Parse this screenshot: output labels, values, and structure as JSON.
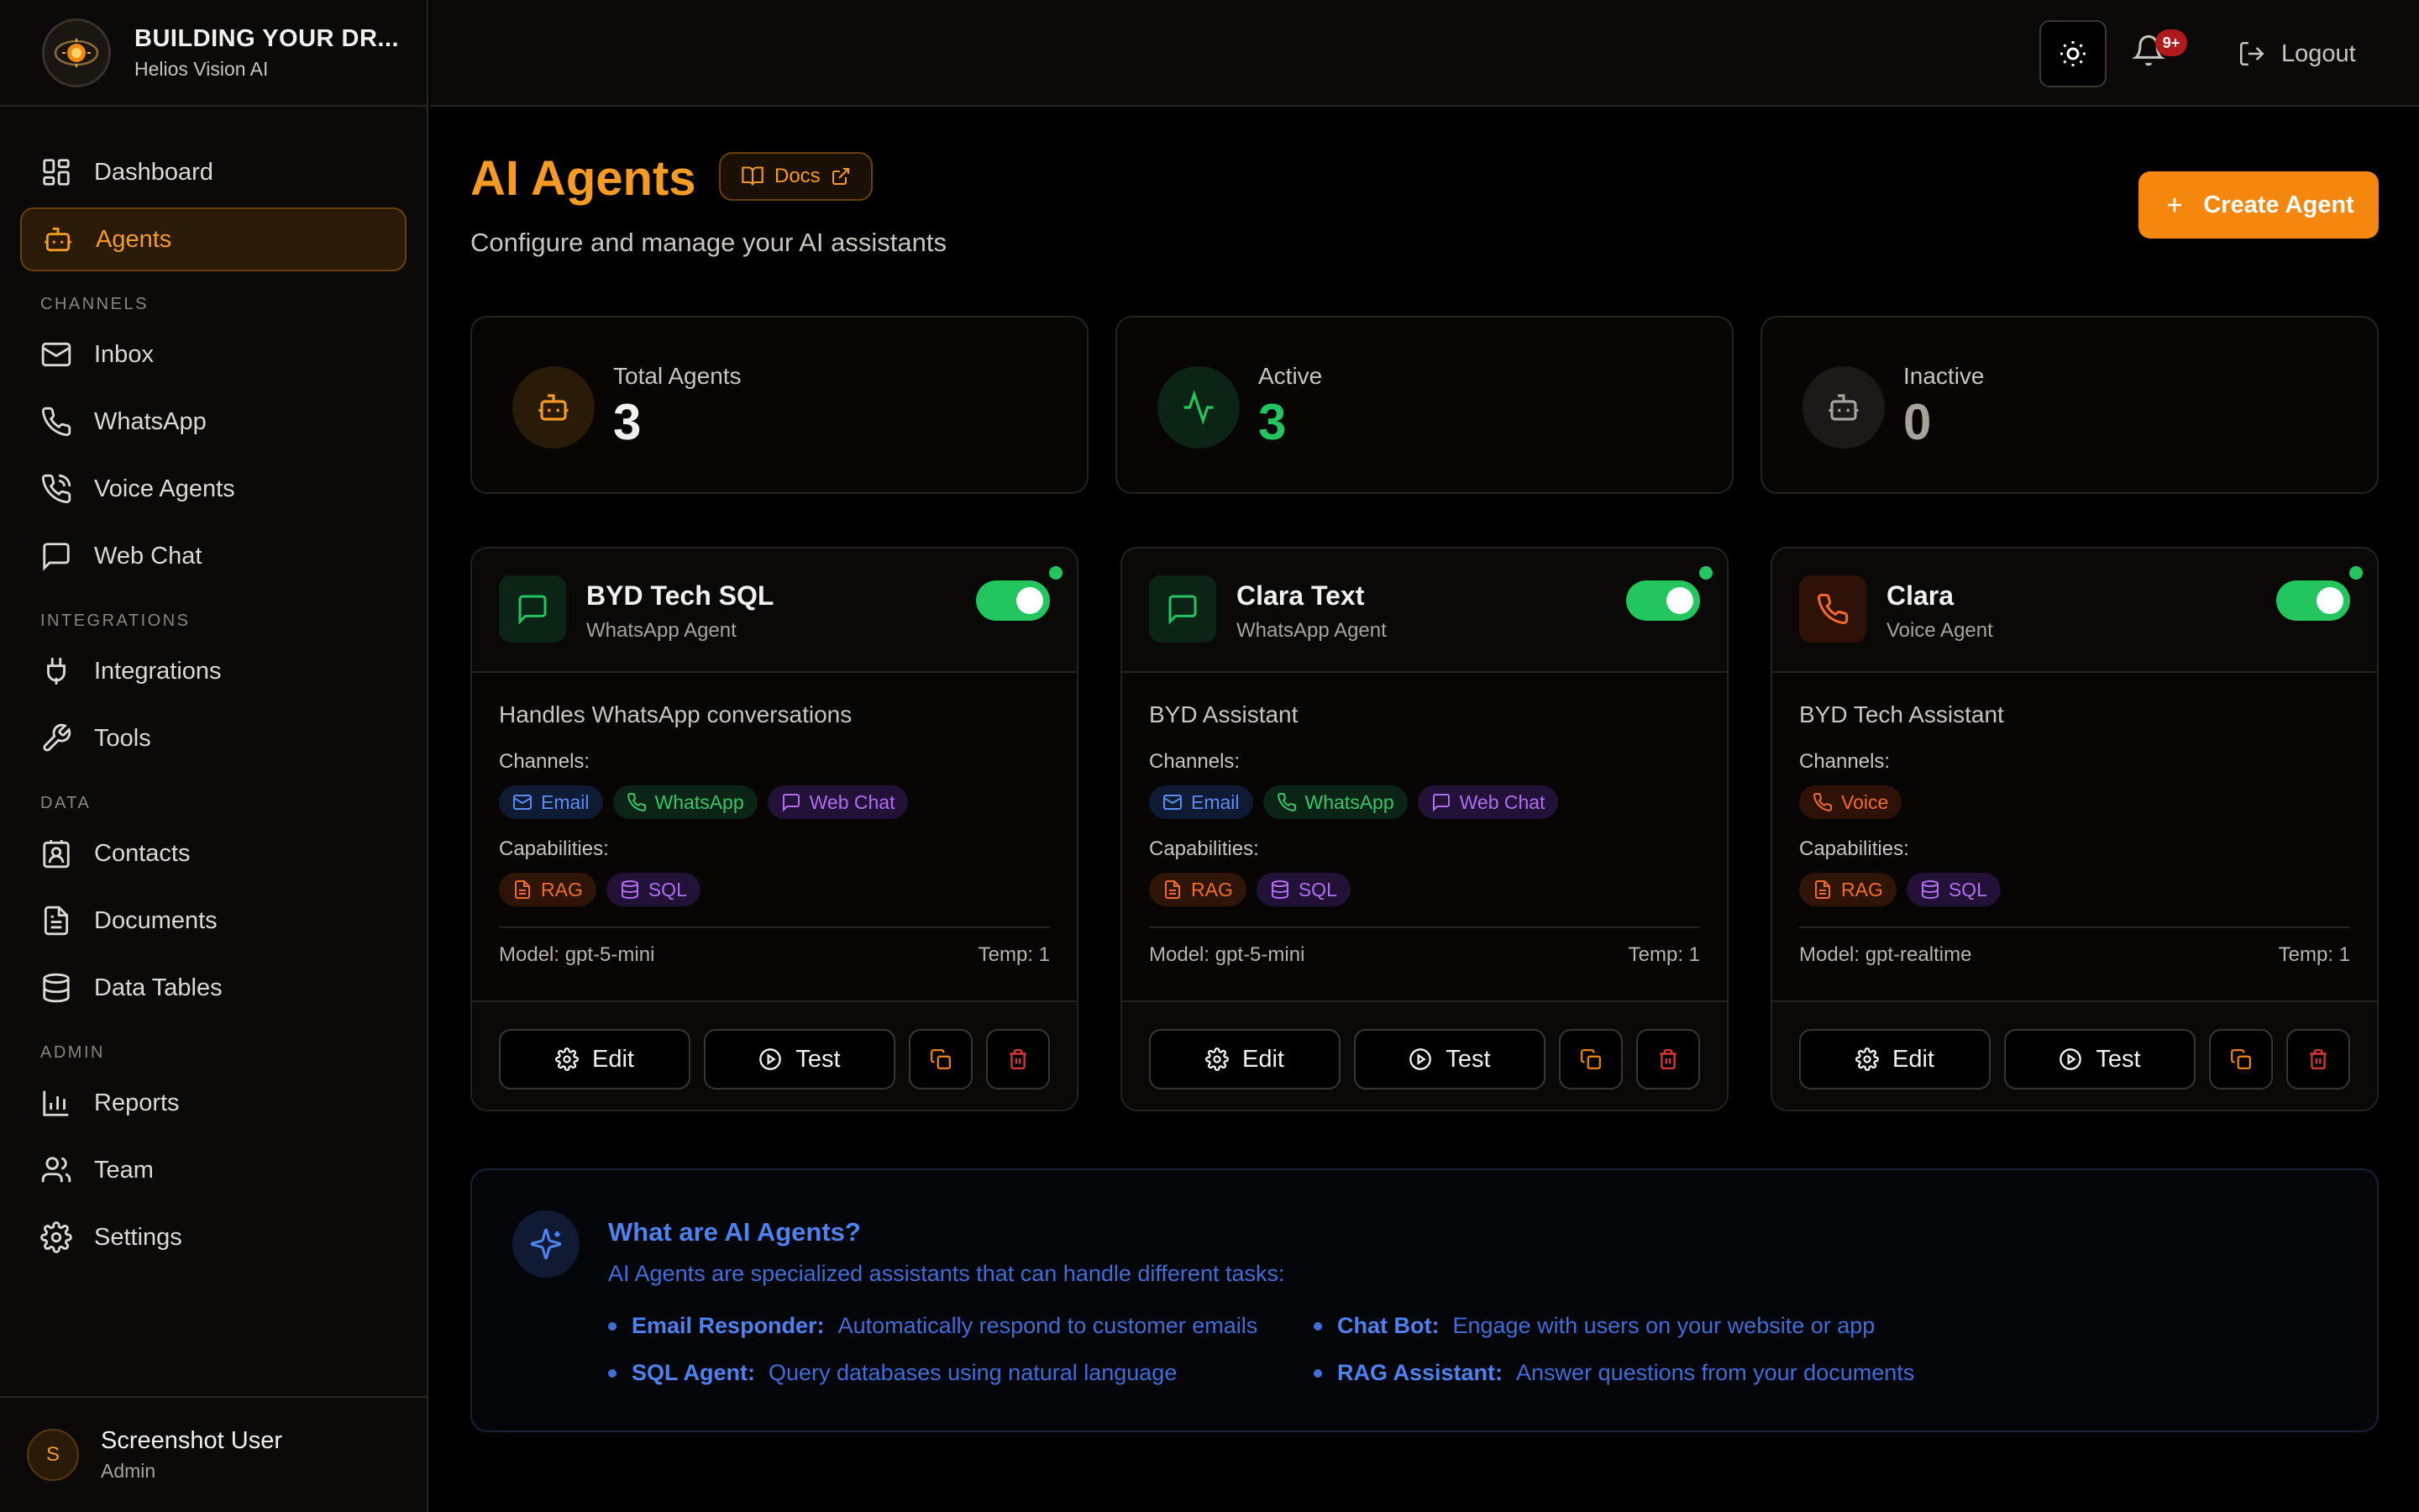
{
  "brand": {
    "title": "BUILDING YOUR DR...",
    "subtitle": "Helios Vision AI"
  },
  "nav": {
    "dashboard": "Dashboard",
    "agents": "Agents",
    "sections": {
      "channels": "CHANNELS",
      "integrations": "INTEGRATIONS",
      "data": "DATA",
      "admin": "ADMIN"
    },
    "inbox": "Inbox",
    "whatsapp": "WhatsApp",
    "voice_agents": "Voice Agents",
    "web_chat": "Web Chat",
    "integrations": "Integrations",
    "tools": "Tools",
    "contacts": "Contacts",
    "documents": "Documents",
    "data_tables": "Data Tables",
    "reports": "Reports",
    "team": "Team",
    "settings": "Settings"
  },
  "user": {
    "initial": "S",
    "name": "Screenshot User",
    "role": "Admin"
  },
  "topbar": {
    "notifications_badge": "9+",
    "logout_label": "Logout"
  },
  "page": {
    "title": "AI Agents",
    "docs_label": "Docs",
    "subtitle": "Configure and manage your AI assistants",
    "create_label": "Create Agent"
  },
  "stats": {
    "total": {
      "label": "Total Agents",
      "value": "3"
    },
    "active": {
      "label": "Active",
      "value": "3"
    },
    "inactive": {
      "label": "Inactive",
      "value": "0"
    }
  },
  "labels": {
    "channels": "Channels:",
    "capabilities": "Capabilities:",
    "edit": "Edit",
    "test": "Test"
  },
  "agents": [
    {
      "name": "BYD Tech SQL",
      "type": "WhatsApp Agent",
      "icon": "message-square-icon",
      "description": "Handles WhatsApp conversations",
      "channels": [
        "Email",
        "WhatsApp",
        "Web Chat"
      ],
      "capabilities": [
        "RAG",
        "SQL"
      ],
      "model": "Model: gpt-5-mini",
      "temp": "Temp: 1",
      "enabled": true
    },
    {
      "name": "Clara Text",
      "type": "WhatsApp Agent",
      "icon": "message-square-icon",
      "description": "BYD Assistant",
      "channels": [
        "Email",
        "WhatsApp",
        "Web Chat"
      ],
      "capabilities": [
        "RAG",
        "SQL"
      ],
      "model": "Model: gpt-5-mini",
      "temp": "Temp: 1",
      "enabled": true
    },
    {
      "name": "Clara",
      "type": "Voice Agent",
      "icon": "phone-icon",
      "description": "BYD Tech Assistant",
      "channels": [
        "Voice"
      ],
      "capabilities": [
        "RAG",
        "SQL"
      ],
      "model": "Model: gpt-realtime",
      "temp": "Temp: 1",
      "enabled": true
    }
  ],
  "info": {
    "title": "What are AI Agents?",
    "description": "AI Agents are specialized assistants that can handle different tasks:",
    "items": [
      {
        "key": "Email Responder:",
        "text": "Automatically respond to customer emails"
      },
      {
        "key": "Chat Bot:",
        "text": "Engage with users on your website or app"
      },
      {
        "key": "SQL Agent:",
        "text": "Query databases using natural language"
      },
      {
        "key": "RAG Assistant:",
        "text": "Answer questions from your documents"
      }
    ]
  },
  "colors": {
    "accent": "#f5870f",
    "active_green": "#22c55e",
    "info_blue": "#4d82f0"
  }
}
